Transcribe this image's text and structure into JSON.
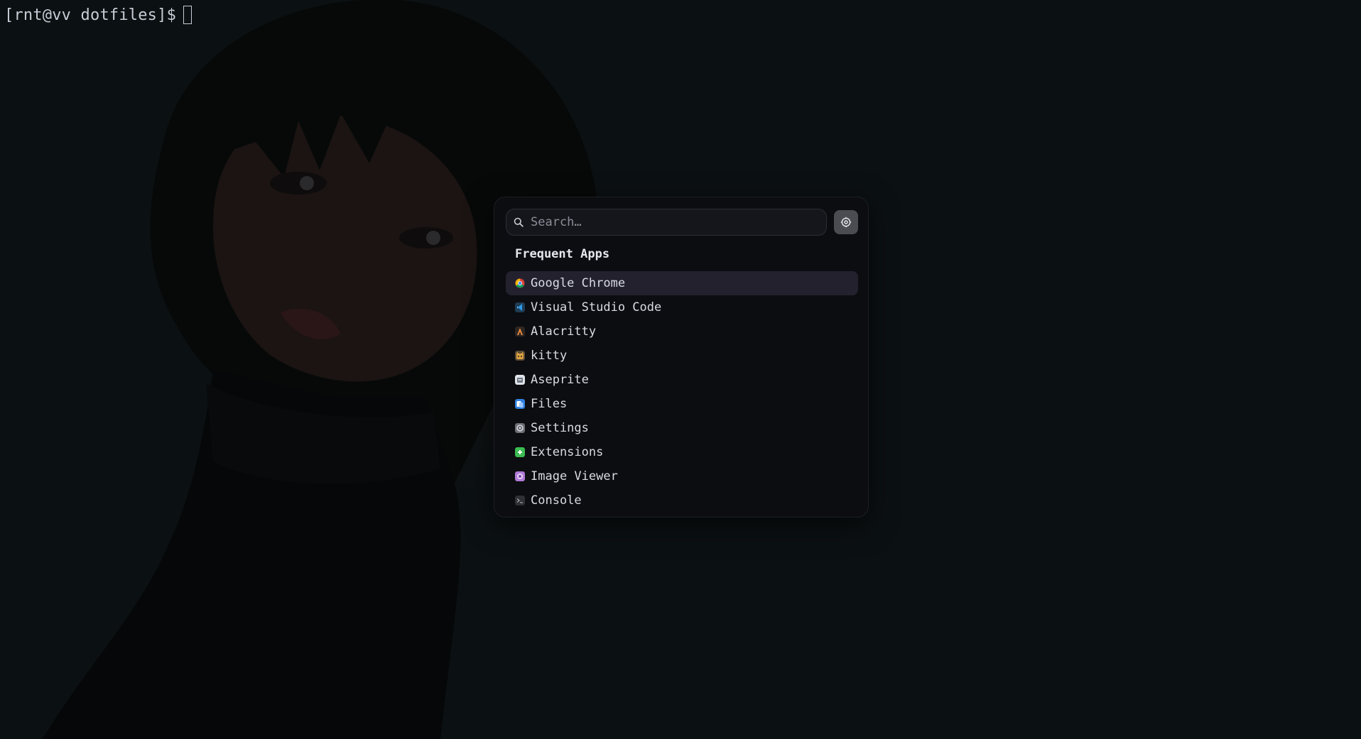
{
  "terminal": {
    "prompt": "[rnt@vv dotfiles]$"
  },
  "launcher": {
    "search": {
      "placeholder": "Search…",
      "value": ""
    },
    "settings_icon": "gear-icon",
    "section_title": "Frequent Apps",
    "apps": [
      {
        "label": "Google Chrome",
        "icon": "chrome-icon",
        "selected": true
      },
      {
        "label": "Visual Studio Code",
        "icon": "vscode-icon",
        "selected": false
      },
      {
        "label": "Alacritty",
        "icon": "alacritty-icon",
        "selected": false
      },
      {
        "label": "kitty",
        "icon": "kitty-icon",
        "selected": false
      },
      {
        "label": "Aseprite",
        "icon": "aseprite-icon",
        "selected": false
      },
      {
        "label": "Files",
        "icon": "files-icon",
        "selected": false
      },
      {
        "label": "Settings",
        "icon": "settings-icon",
        "selected": false
      },
      {
        "label": "Extensions",
        "icon": "extensions-icon",
        "selected": false
      },
      {
        "label": "Image Viewer",
        "icon": "image-viewer-icon",
        "selected": false
      },
      {
        "label": "Console",
        "icon": "console-icon",
        "selected": false
      }
    ]
  },
  "colors": {
    "background": "#0b1012",
    "launcher_bg": "#0c0d10",
    "selected_row": "#24212f",
    "text": "#d8dbe2"
  }
}
